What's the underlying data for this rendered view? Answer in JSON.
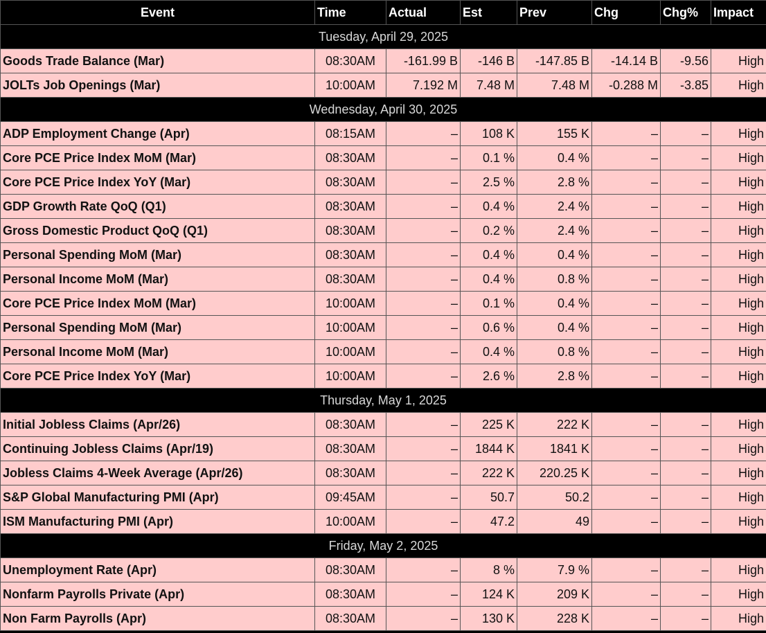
{
  "columns": [
    "Event",
    "Time",
    "Actual",
    "Est",
    "Prev",
    "Chg",
    "Chg%",
    "Impact"
  ],
  "groups": [
    {
      "date": "Tuesday, April 29, 2025",
      "rows": [
        [
          "Goods Trade Balance (Mar)",
          "08:30AM",
          "-161.99 B",
          "-146 B",
          "-147.85 B",
          "-14.14 B",
          "-9.56",
          "High"
        ],
        [
          "JOLTs Job Openings (Mar)",
          "10:00AM",
          "7.192 M",
          "7.48 M",
          "7.48 M",
          "-0.288 M",
          "-3.85",
          "High"
        ]
      ]
    },
    {
      "date": "Wednesday, April 30, 2025",
      "rows": [
        [
          "ADP Employment Change (Apr)",
          "08:15AM",
          "–",
          "108 K",
          "155 K",
          "–",
          "–",
          "High"
        ],
        [
          "Core PCE Price Index MoM (Mar)",
          "08:30AM",
          "–",
          "0.1 %",
          "0.4 %",
          "–",
          "–",
          "High"
        ],
        [
          "Core PCE Price Index YoY (Mar)",
          "08:30AM",
          "–",
          "2.5 %",
          "2.8 %",
          "–",
          "–",
          "High"
        ],
        [
          "GDP Growth Rate QoQ (Q1)",
          "08:30AM",
          "–",
          "0.4 %",
          "2.4 %",
          "–",
          "–",
          "High"
        ],
        [
          "Gross Domestic Product QoQ (Q1)",
          "08:30AM",
          "–",
          "0.2 %",
          "2.4 %",
          "–",
          "–",
          "High"
        ],
        [
          "Personal Spending MoM (Mar)",
          "08:30AM",
          "–",
          "0.4 %",
          "0.4 %",
          "–",
          "–",
          "High"
        ],
        [
          "Personal Income MoM (Mar)",
          "08:30AM",
          "–",
          "0.4 %",
          "0.8 %",
          "–",
          "–",
          "High"
        ],
        [
          "Core PCE Price Index MoM (Mar)",
          "10:00AM",
          "–",
          "0.1 %",
          "0.4 %",
          "–",
          "–",
          "High"
        ],
        [
          "Personal Spending MoM (Mar)",
          "10:00AM",
          "–",
          "0.6 %",
          "0.4 %",
          "–",
          "–",
          "High"
        ],
        [
          "Personal Income MoM (Mar)",
          "10:00AM",
          "–",
          "0.4 %",
          "0.8 %",
          "–",
          "–",
          "High"
        ],
        [
          "Core PCE Price Index YoY (Mar)",
          "10:00AM",
          "–",
          "2.6 %",
          "2.8 %",
          "–",
          "–",
          "High"
        ]
      ]
    },
    {
      "date": "Thursday, May 1, 2025",
      "rows": [
        [
          "Initial Jobless Claims (Apr/26)",
          "08:30AM",
          "–",
          "225 K",
          "222 K",
          "–",
          "–",
          "High"
        ],
        [
          "Continuing Jobless Claims (Apr/19)",
          "08:30AM",
          "–",
          "1844 K",
          "1841 K",
          "–",
          "–",
          "High"
        ],
        [
          "Jobless Claims 4-Week Average (Apr/26)",
          "08:30AM",
          "–",
          "222 K",
          "220.25 K",
          "–",
          "–",
          "High"
        ],
        [
          "S&P Global Manufacturing PMI (Apr)",
          "09:45AM",
          "–",
          "50.7",
          "50.2",
          "–",
          "–",
          "High"
        ],
        [
          "ISM Manufacturing PMI (Apr)",
          "10:00AM",
          "–",
          "47.2",
          "49",
          "–",
          "–",
          "High"
        ]
      ]
    },
    {
      "date": "Friday, May 2, 2025",
      "rows": [
        [
          "Unemployment Rate (Apr)",
          "08:30AM",
          "–",
          "8 %",
          "7.9 %",
          "–",
          "–",
          "High"
        ],
        [
          "Nonfarm Payrolls Private (Apr)",
          "08:30AM",
          "–",
          "124 K",
          "209 K",
          "–",
          "–",
          "High"
        ],
        [
          "Non Farm Payrolls (Apr)",
          "08:30AM",
          "–",
          "130 K",
          "228 K",
          "–",
          "–",
          "High"
        ]
      ]
    }
  ]
}
